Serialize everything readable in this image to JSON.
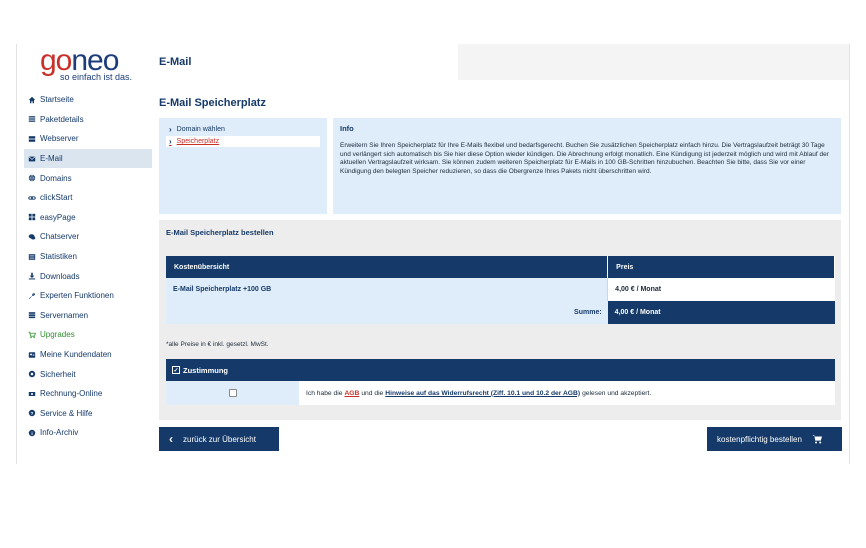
{
  "logo": {
    "part1": "go",
    "part2": "neo",
    "tagline": "so einfach ist das."
  },
  "header": {
    "title": "E-Mail"
  },
  "sidebar": {
    "items": [
      {
        "label": "Startseite",
        "icon": "home-icon"
      },
      {
        "label": "Paketdetails",
        "icon": "list-icon"
      },
      {
        "label": "Webserver",
        "icon": "server-icon"
      },
      {
        "label": "E-Mail",
        "icon": "envelope-icon",
        "active": true
      },
      {
        "label": "Domains",
        "icon": "globe-icon"
      },
      {
        "label": "clickStart",
        "icon": "link-icon"
      },
      {
        "label": "easyPage",
        "icon": "grid-icon"
      },
      {
        "label": "Chatserver",
        "icon": "chat-icon"
      },
      {
        "label": "Statistiken",
        "icon": "stats-icon"
      },
      {
        "label": "Downloads",
        "icon": "download-icon"
      },
      {
        "label": "Experten Funktionen",
        "icon": "wrench-icon"
      },
      {
        "label": "Servernamen",
        "icon": "servernames-icon"
      },
      {
        "label": "Upgrades",
        "icon": "cart-icon",
        "green": true
      },
      {
        "label": "Meine Kundendaten",
        "icon": "user-icon"
      },
      {
        "label": "Sicherheit",
        "icon": "lock-icon"
      },
      {
        "label": "Rechnung-Online",
        "icon": "invoice-icon"
      },
      {
        "label": "Service & Hilfe",
        "icon": "help-icon"
      },
      {
        "label": "Info-Archiv",
        "icon": "info-icon"
      }
    ]
  },
  "main": {
    "title": "E-Mail Speicherplatz",
    "steps": [
      {
        "label": "Domain wählen"
      },
      {
        "label": "Speicherplatz",
        "active": true
      }
    ],
    "info": {
      "title": "Info",
      "text": "Erweitern Sie Ihren Speicherplatz für Ihre E-Mails flexibel und bedarfsgerecht. Buchen Sie zusätzlichen Speicherplatz einfach hinzu. Die Vertragslaufzeit beträgt 30 Tage und verlängert sich automatisch bis Sie hier diese Option wieder kündigen. Die Abrechnung erfolgt monatlich. Eine Kündigung ist jederzeit möglich und wird mit Ablauf der aktuellen Vertragslaufzeit wirksam. Sie können zudem weiteren Speicherplatz für E-Mails in 100 GB-Schritten hinzubuchen. Beachten Sie bitte, dass Sie vor einer Kündigung den belegten Speicher reduzieren, so dass die Obergrenze Ihres Pakets nicht überschritten wird."
    },
    "order": {
      "title": "E-Mail Speicherplatz bestellen",
      "table": {
        "col_item": "Kostenübersicht",
        "col_price": "Preis",
        "row_item": "E-Mail Speicherplatz +100 GB",
        "row_price": "4,00 € / Monat",
        "sum_label": "Summe:",
        "sum_value": "4,00 € / Monat"
      },
      "price_note": "*alle Preise in € inkl. gesetzl. MwSt.",
      "consent": {
        "title": "Zustimmung",
        "text_pre": "Ich habe die",
        "agb_link": "AGB",
        "text_mid": "und die",
        "widerruf_link": "Hinweise auf das Widerrufsrecht (Ziff. 10.1 und 10.2 der AGB)",
        "text_post": "gelesen und akzeptiert."
      }
    },
    "buttons": {
      "back": "zurück zur Übersicht",
      "order": "kostenpflichtig bestellen"
    }
  },
  "colors": {
    "navy": "#153a69",
    "light_blue": "#dfecf9",
    "brand_red": "#c8312a",
    "upgrade_green": "#2f8f2f"
  }
}
